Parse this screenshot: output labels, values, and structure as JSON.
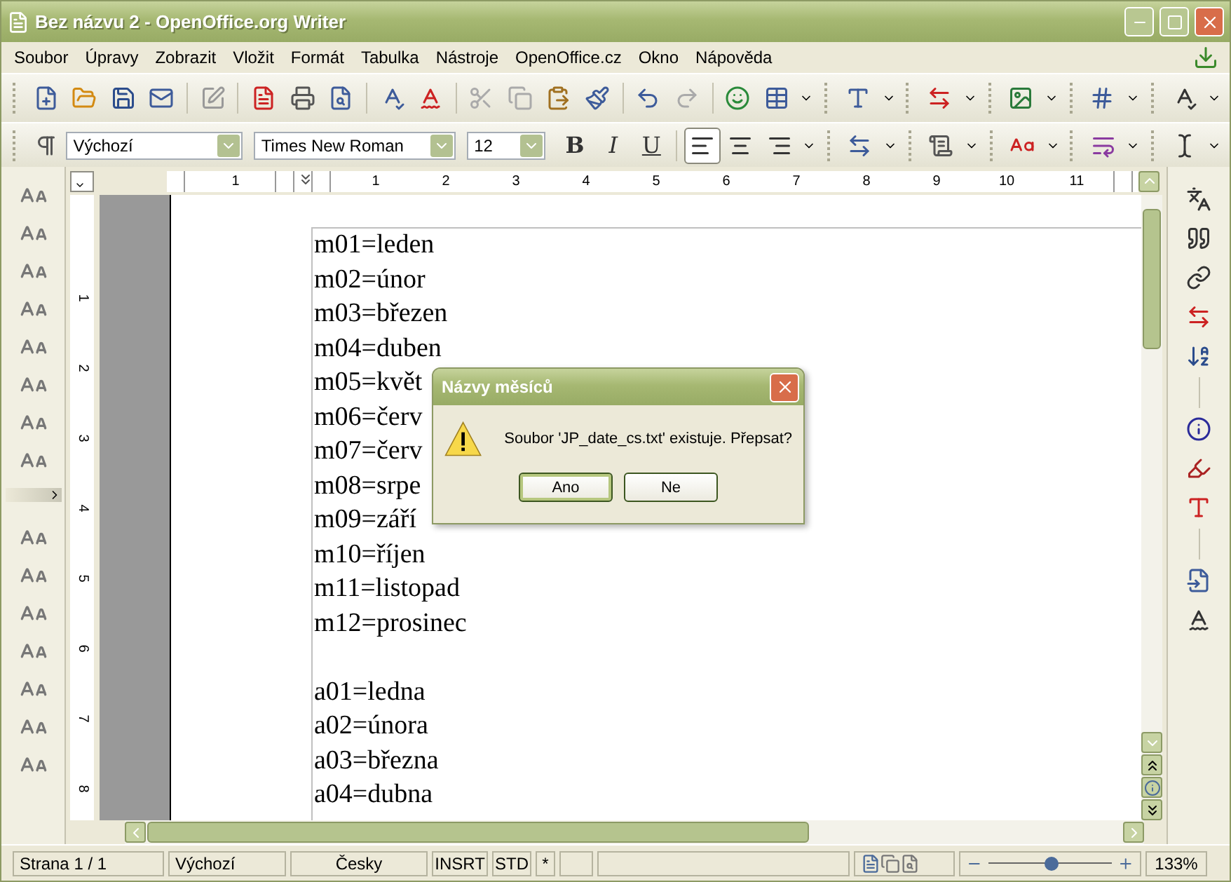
{
  "window": {
    "title": "Bez názvu 2 - OpenOffice.org Writer"
  },
  "menu": [
    "Soubor",
    "Úpravy",
    "Zobrazit",
    "Vložit",
    "Formát",
    "Tabulka",
    "Nástroje",
    "OpenOffice.cz",
    "Okno",
    "Nápověda"
  ],
  "formatting": {
    "style": "Výchozí",
    "font": "Times New Roman",
    "size": "12",
    "bold": "B",
    "italic": "I",
    "underline": "U",
    "alignment": [
      {
        "kind": "left",
        "selected": true
      },
      {
        "kind": "center",
        "selected": false
      },
      {
        "kind": "right",
        "selected": false
      }
    ]
  },
  "ruler": {
    "horizontal": [
      "1",
      "1",
      "2",
      "3",
      "4",
      "5",
      "6",
      "7",
      "8",
      "9",
      "10",
      "11"
    ],
    "vertical": [
      "1",
      "2",
      "3",
      "4",
      "5",
      "6",
      "7",
      "8"
    ]
  },
  "document": {
    "blocks": [
      [
        "m01=leden",
        "m02=únor",
        "m03=březen",
        "m04=duben",
        "m05=květ",
        "m06=červ",
        "m07=červ",
        "m08=srpe",
        "m09=září",
        "m10=říjen",
        "m11=listopad",
        "m12=prosinec"
      ],
      [
        "a01=ledna",
        "a02=února",
        "a03=března",
        "a04=dubna"
      ]
    ]
  },
  "dialog": {
    "title": "Názvy měsíců",
    "message": "Soubor 'JP_date_cs.txt' existuje. Přepsat?",
    "buttons": [
      {
        "label": "Ano",
        "default": true
      },
      {
        "label": "Ne",
        "default": false
      }
    ]
  },
  "status_bar": {
    "page": "Strana 1 / 1",
    "style": "Výchozí",
    "language": "Česky",
    "mode": "INSRT",
    "selection": "STD",
    "modified": "*",
    "zoom": {
      "level": 0.5
    },
    "zoom_reading": "133%"
  }
}
